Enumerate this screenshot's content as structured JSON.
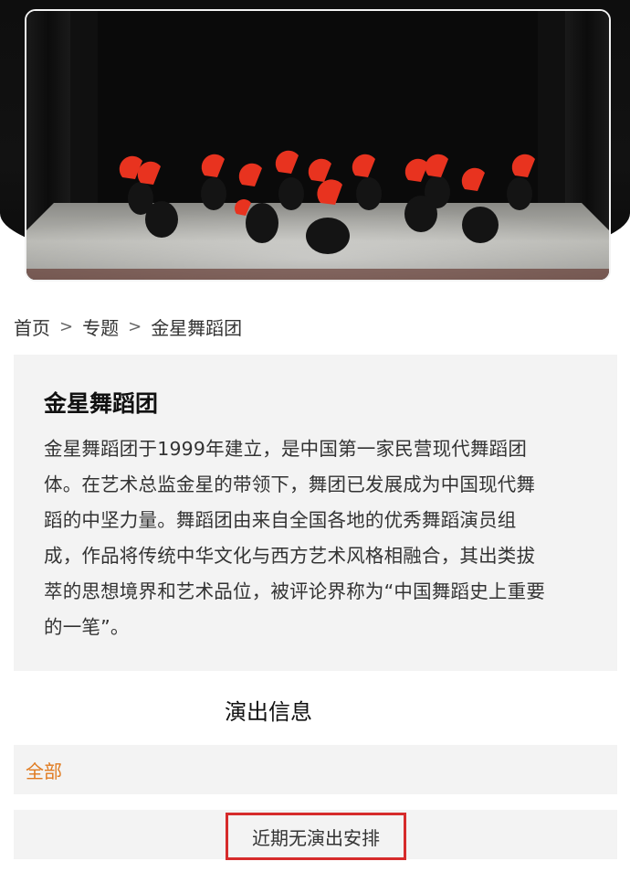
{
  "banner": {
    "image": "dance-performance-red-fans-photo"
  },
  "breadcrumb": {
    "home": "首页",
    "topics": "专题",
    "current": "金星舞蹈团",
    "separator": ">"
  },
  "intro": {
    "title": "金星舞蹈团",
    "lines": [
      "金星舞蹈团于1999年建立，是中国第一家民营现代舞蹈团",
      "体。在艺术总监金星的带领下，舞团已发展成为中国现代舞",
      "蹈的中坚力量。舞蹈团由来自全国各地的优秀舞蹈演员组",
      "成，作品将传统中华文化与西方艺术风格相融合，其出类拔",
      "萃的思想境界和艺术品位，被评论界称为“中国舞蹈史上重要",
      "的一笔”。"
    ]
  },
  "performance": {
    "section_title": "演出信息",
    "filter_all": "全部",
    "empty_message": "近期无演出安排"
  },
  "colors": {
    "accent_orange": "#e07a1f",
    "highlight_red": "#d62b2b",
    "card_bg": "#f3f3f3",
    "fan_red": "#e8331f"
  }
}
